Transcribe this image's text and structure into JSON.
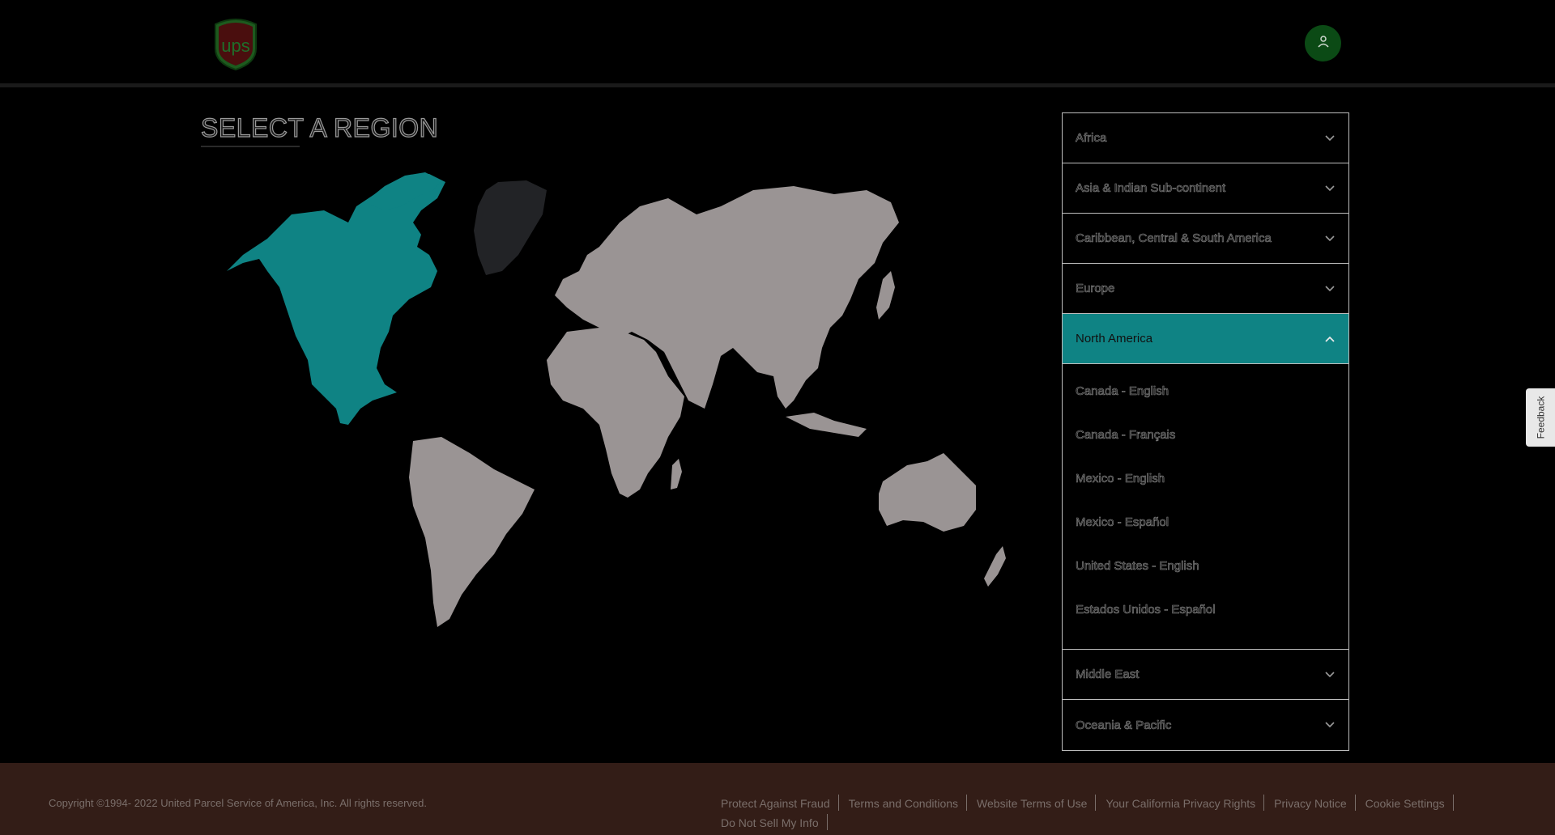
{
  "header": {
    "logo_text": "ups",
    "logo_icon": "ups-shield-logo-icon",
    "account_icon": "user-icon"
  },
  "main": {
    "title": "SELECT A REGION"
  },
  "regions": {
    "items": [
      {
        "label": "Africa",
        "expanded": false
      },
      {
        "label": "Asia & Indian Sub-continent",
        "expanded": false
      },
      {
        "label": "Caribbean, Central & South America",
        "expanded": false
      },
      {
        "label": "Europe",
        "expanded": false
      },
      {
        "label": "North America",
        "expanded": true
      },
      {
        "label": "Middle East",
        "expanded": false
      },
      {
        "label": "Oceania & Pacific",
        "expanded": false
      }
    ],
    "north_america_locales": [
      "Canada - English",
      "Canada - Français",
      "Mexico - English",
      "Mexico - Español",
      "United States - English",
      "Estados Unidos - Español"
    ]
  },
  "feedback": {
    "label": "Feedback"
  },
  "footer": {
    "copyright": "Copyright ©1994- 2022  United Parcel Service of America, Inc. All rights reserved.",
    "links": [
      "Protect Against Fraud",
      "Terms and Conditions",
      "Website Terms of Use",
      "Your California Privacy Rights",
      "Privacy Notice",
      "Cookie Settings",
      "Do Not Sell My Info"
    ]
  },
  "colors": {
    "highlight": "#0f8384",
    "land": "#9a9494",
    "greenland": "#222326",
    "footer_bg": "#331d17"
  }
}
